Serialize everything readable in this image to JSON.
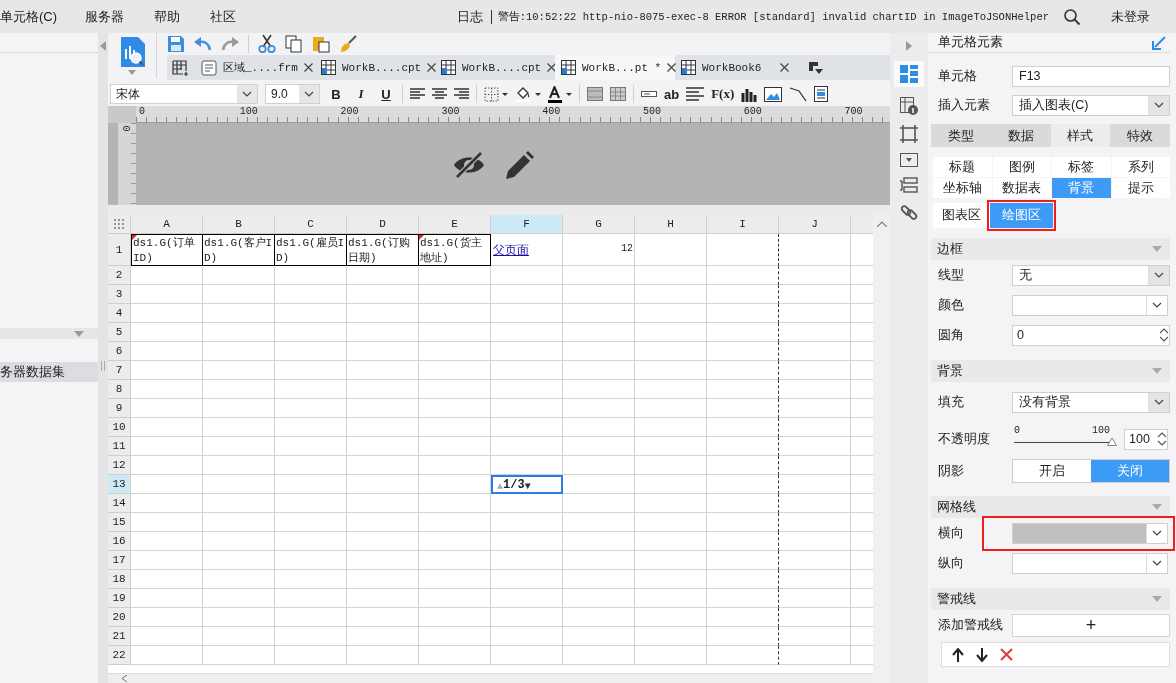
{
  "menu_bar": {
    "items": [
      "单元格(C)",
      "服务器",
      "帮助",
      "社区"
    ],
    "log_label": "日志",
    "log_message": "警告:10:52:22 http-nio-8075-exec-8 ERROR [standard] invalid chartID in ImageToJSONHelper",
    "login": "未登录"
  },
  "left_panel": {
    "dataset_item": "务器数据集"
  },
  "editor_tabs": [
    {
      "label": "区域_....frm",
      "selected": false,
      "kind": "form"
    },
    {
      "label": "WorkB....cpt",
      "selected": false,
      "kind": "report"
    },
    {
      "label": "WorkB....cpt",
      "selected": false,
      "kind": "report"
    },
    {
      "label": "WorkB...pt *",
      "selected": true,
      "kind": "report"
    },
    {
      "label": "WorkBook6",
      "selected": false,
      "kind": "report"
    }
  ],
  "format_toolbar": {
    "font": "宋体",
    "size": "9.0",
    "style_buttons": [
      "B",
      "I",
      "U"
    ],
    "text_label": "ab",
    "formula_label": "F(x)"
  },
  "ruler": {
    "ticks": [
      "0",
      "100",
      "200",
      "300",
      "400",
      "500",
      "600",
      "700"
    ],
    "vertical_tick": "0"
  },
  "sheet": {
    "columns": [
      {
        "label": "A",
        "selected": false
      },
      {
        "label": "B",
        "selected": false
      },
      {
        "label": "C",
        "selected": false
      },
      {
        "label": "D",
        "selected": false
      },
      {
        "label": "E",
        "selected": false
      },
      {
        "label": "F",
        "selected": true
      },
      {
        "label": "G",
        "selected": false
      },
      {
        "label": "H",
        "selected": false
      },
      {
        "label": "I",
        "selected": false
      },
      {
        "label": "J",
        "selected": false
      }
    ],
    "rows": [
      {
        "label": "1",
        "selected": false
      },
      {
        "label": "2",
        "selected": false
      },
      {
        "label": "3",
        "selected": false
      },
      {
        "label": "4",
        "selected": false
      },
      {
        "label": "5",
        "selected": false
      },
      {
        "label": "6",
        "selected": false
      },
      {
        "label": "7",
        "selected": false
      },
      {
        "label": "8",
        "selected": false
      },
      {
        "label": "9",
        "selected": false
      },
      {
        "label": "10",
        "selected": false
      },
      {
        "label": "11",
        "selected": false
      },
      {
        "label": "12",
        "selected": false
      },
      {
        "label": "13",
        "selected": true
      },
      {
        "label": "14",
        "selected": false
      },
      {
        "label": "15",
        "selected": false
      },
      {
        "label": "16",
        "selected": false
      },
      {
        "label": "17",
        "selected": false
      },
      {
        "label": "18",
        "selected": false
      },
      {
        "label": "19",
        "selected": false
      },
      {
        "label": "20",
        "selected": false
      },
      {
        "label": "21",
        "selected": false
      },
      {
        "label": "22",
        "selected": false
      }
    ],
    "cells": [
      {
        "text": "ds1.G(订单ID)",
        "flagged": true
      },
      {
        "text": "ds1.G(客户ID)",
        "flagged": false
      },
      {
        "text": "ds1.G(雇员ID)",
        "flagged": false
      },
      {
        "text": "ds1.G(订购日期)",
        "flagged": false
      },
      {
        "text": "ds1.G(货主地址)",
        "flagged": true
      }
    ],
    "link": "父页面",
    "number": "12",
    "pager": {
      "prev": "▲",
      "page": "1/3",
      "next": "▼"
    }
  },
  "side_panel": {
    "title": "单元格元素",
    "cell": {
      "label": "单元格",
      "value": "F13"
    },
    "insert": {
      "label": "插入元素",
      "value": "插入图表(C)"
    },
    "tabs": [
      {
        "label": "类型",
        "selected": false
      },
      {
        "label": "数据",
        "selected": false
      },
      {
        "label": "样式",
        "selected": true
      },
      {
        "label": "特效",
        "selected": false
      }
    ],
    "sub_tabs": [
      {
        "label": "标题",
        "selected": false
      },
      {
        "label": "图例",
        "selected": false
      },
      {
        "label": "标签",
        "selected": false
      },
      {
        "label": "系列",
        "selected": false
      },
      {
        "label": "坐标轴",
        "selected": false
      },
      {
        "label": "数据表",
        "selected": false
      },
      {
        "label": "背景",
        "selected": true
      },
      {
        "label": "提示",
        "selected": false
      }
    ],
    "area_tabs": [
      {
        "label": "图表区",
        "selected": false,
        "highlighted": false
      },
      {
        "label": "绘图区",
        "selected": true,
        "highlighted": true
      }
    ],
    "sections": [
      {
        "title": "边框",
        "rows": [
          {
            "kind": "select",
            "label": "线型",
            "value": "无"
          },
          {
            "kind": "color",
            "label": "颜色",
            "highlighted": false
          },
          {
            "kind": "spinner",
            "label": "圆角",
            "value": "0"
          }
        ]
      },
      {
        "title": "背景",
        "rows": [
          {
            "kind": "select",
            "label": "填充",
            "value": "没有背景"
          },
          {
            "kind": "slider",
            "label": "不透明度",
            "min": "0",
            "max": "100",
            "level": 1,
            "value": "100"
          },
          {
            "kind": "toggle",
            "label": "阴影",
            "options": [
              {
                "label": "开启",
                "selected": false
              },
              {
                "label": "关闭",
                "selected": true
              }
            ]
          }
        ]
      },
      {
        "title": "网格线",
        "rows": [
          {
            "kind": "color",
            "label": "横向",
            "color": "#c0c0c0",
            "highlighted": true
          },
          {
            "kind": "color",
            "label": "纵向",
            "highlighted": false
          }
        ]
      },
      {
        "title": "警戒线",
        "rows": [
          {
            "kind": "add",
            "label": "添加警戒线",
            "button": "+"
          },
          {
            "kind": "list"
          }
        ]
      }
    ]
  }
}
